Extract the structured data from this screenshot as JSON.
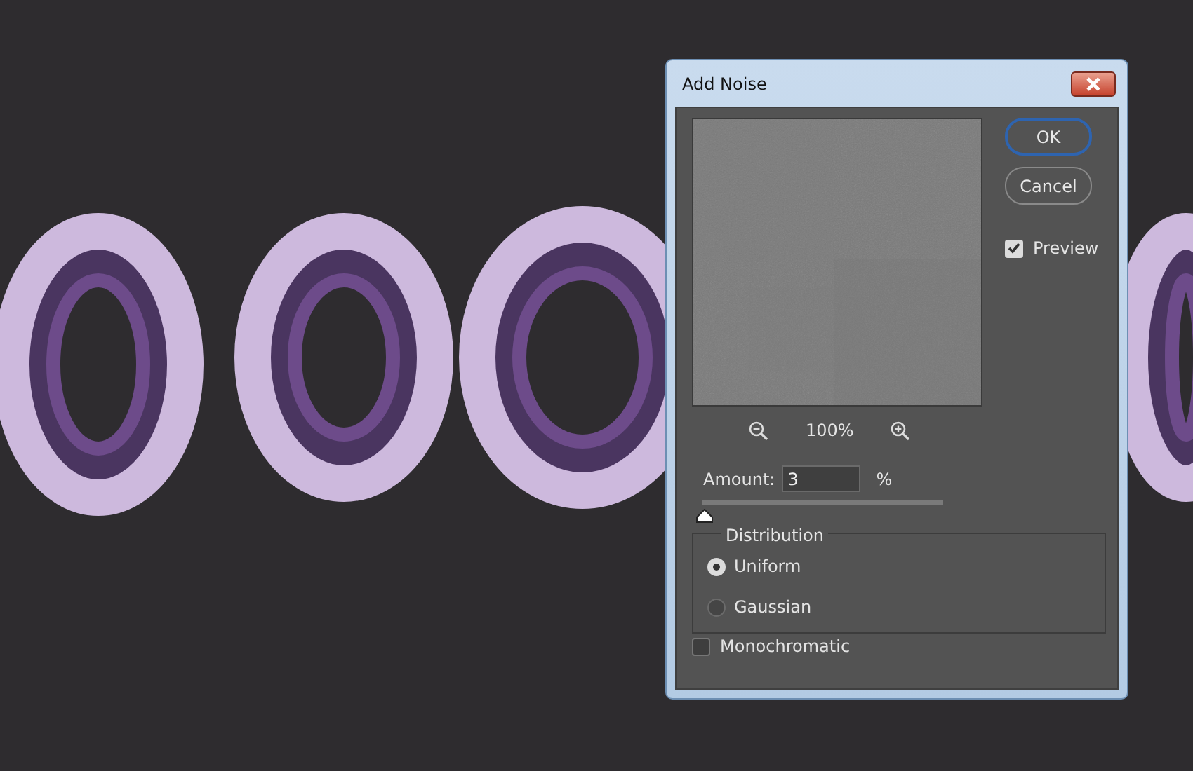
{
  "dialog": {
    "title": "Add Noise",
    "buttons": [
      {
        "label": "OK",
        "default": true
      },
      {
        "label": "Cancel",
        "default": false
      }
    ],
    "preview": {
      "label": "Preview",
      "checked": true
    },
    "zoom": {
      "reading": "100%"
    },
    "amount": {
      "label": "Amount:",
      "value": "3",
      "unit": "%",
      "level": 0.01
    },
    "distribution": {
      "legend": "Distribution",
      "options": [
        {
          "label": "Uniform",
          "selected": true
        },
        {
          "label": "Gaussian",
          "selected": false
        }
      ]
    },
    "monochromatic": {
      "label": "Monochromatic",
      "checked": false
    }
  }
}
